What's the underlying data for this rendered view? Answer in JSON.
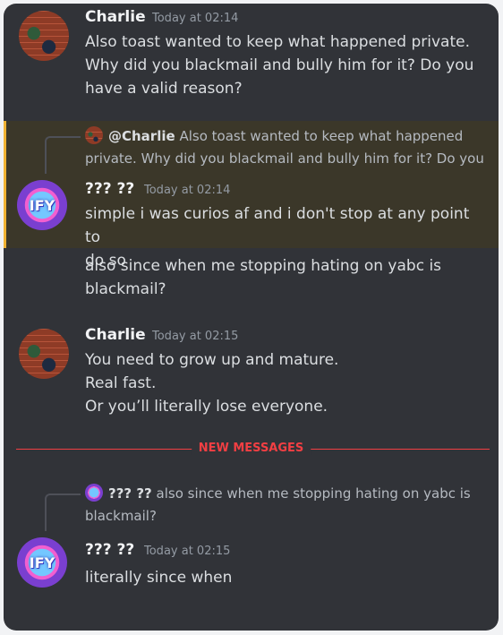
{
  "messages": [
    {
      "username": "Charlie",
      "timestamp": "Today at 02:14",
      "lines": [
        "Also toast wanted to keep what happened private.",
        "Why did you blackmail and bully him for it? Do you",
        "have a valid reason?"
      ]
    },
    {
      "reply": {
        "mention": "@Charlie",
        "line1": "Also toast wanted to keep what happened",
        "line2": "private. Why did you blackmail and bully him for it? Do you ..."
      },
      "username": "??? ??",
      "timestamp": "Today at 02:14",
      "avatar_text": "IFY",
      "lines": [
        "simple i was curios af and i don't stop at any point to",
        "do so"
      ]
    },
    {
      "lines": [
        "also since when me stopping hating on yabc is",
        "blackmail?"
      ]
    },
    {
      "username": "Charlie",
      "timestamp": "Today at 02:15",
      "lines": [
        "You need to grow up and mature.",
        "Real fast.",
        "Or you’ll literally lose everyone."
      ]
    },
    {
      "reply": {
        "mention": "??? ??",
        "line1": "also since when me stopping hating on yabc is",
        "line2": "blackmail?"
      },
      "username": "??? ??",
      "timestamp": "Today at 02:15",
      "avatar_text": "IFY",
      "lines": [
        "literally since when"
      ]
    }
  ],
  "divider": {
    "label": "NEW MESSAGES"
  },
  "colors": {
    "background": "#313338",
    "highlight": "#3b3729",
    "highlight_border": "#f0b232",
    "new_messages": "#f23f43"
  }
}
